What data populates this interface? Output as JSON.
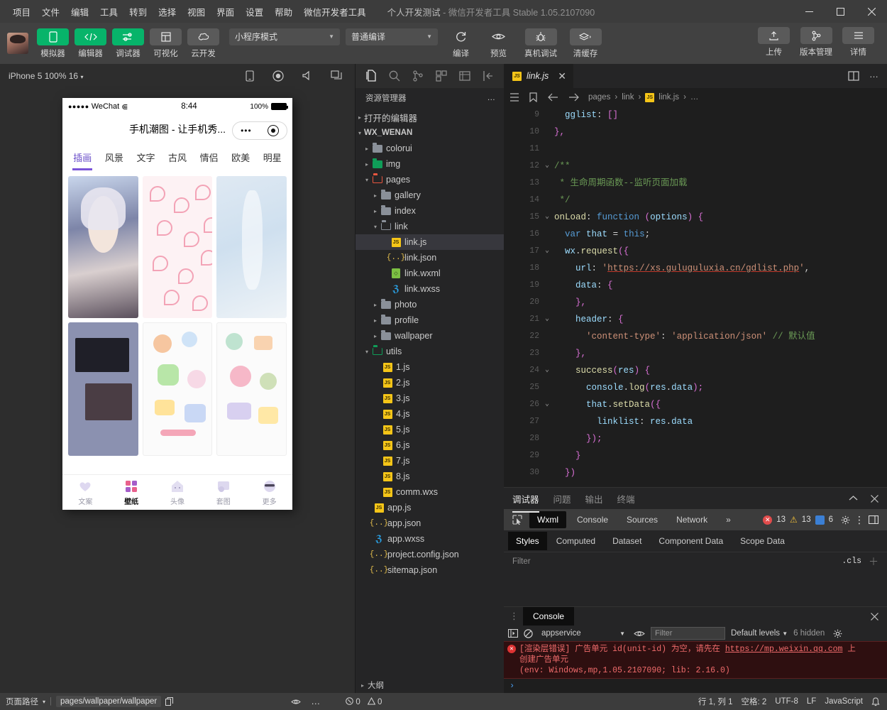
{
  "titlebar": {
    "menus": [
      "项目",
      "文件",
      "编辑",
      "工具",
      "转到",
      "选择",
      "视图",
      "界面",
      "设置",
      "帮助",
      "微信开发者工具"
    ],
    "project_name": "个人开发测试",
    "app_name": " - 微信开发者工具 ",
    "version": "Stable 1.05.2107090",
    "minimize": "—",
    "maximize": "▢",
    "close": "✕"
  },
  "toolbar": {
    "left_buttons": [
      {
        "label": "模拟器",
        "icon": "phone-icon",
        "active": true
      },
      {
        "label": "编辑器",
        "icon": "code-icon",
        "active": true
      },
      {
        "label": "调试器",
        "icon": "debug-icon",
        "active": true
      },
      {
        "label": "可视化",
        "icon": "layout-icon",
        "active": false
      },
      {
        "label": "云开发",
        "icon": "cloud-icon",
        "active": false
      }
    ],
    "mode_select": "小程序模式",
    "compile_select": "普通编译",
    "actions": [
      {
        "label": "编译",
        "icon": "refresh-icon"
      },
      {
        "label": "预览",
        "icon": "eye-icon"
      },
      {
        "label": "真机调试",
        "icon": "bug-icon"
      },
      {
        "label": "清缓存",
        "icon": "layers-icon"
      }
    ],
    "right_buttons": [
      {
        "label": "上传",
        "icon": "upload-icon"
      },
      {
        "label": "版本管理",
        "icon": "branch-icon"
      },
      {
        "label": "详情",
        "icon": "menu-icon"
      }
    ]
  },
  "simulator": {
    "device": "iPhone 5 100% 16",
    "toolbar_icons": [
      "rotate-icon",
      "record-icon",
      "volume-icon",
      "window-icon"
    ],
    "status": {
      "carrier_dots": "●●●●●",
      "carrier": "WeChat",
      "wifi": "⋐",
      "time": "8:44",
      "battery_pct": "100%"
    },
    "nav_title": "手机潮图 - 让手机秀...",
    "categories": [
      {
        "label": "插画",
        "active": true
      },
      {
        "label": "风景",
        "active": false
      },
      {
        "label": "文字",
        "active": false
      },
      {
        "label": "古风",
        "active": false
      },
      {
        "label": "情侣",
        "active": false
      },
      {
        "label": "欧美",
        "active": false
      },
      {
        "label": "明星",
        "active": false
      }
    ],
    "tabbar": [
      {
        "label": "文案",
        "icon": "heart-icon",
        "active": false
      },
      {
        "label": "壁纸",
        "icon": "grid-icon",
        "active": true
      },
      {
        "label": "头像",
        "icon": "house-icon",
        "active": false
      },
      {
        "label": "套图",
        "icon": "sticker-icon",
        "active": false
      },
      {
        "label": "更多",
        "icon": "more-face-icon",
        "active": false
      }
    ]
  },
  "explorer": {
    "activity_icons": [
      "files-icon",
      "search-icon",
      "source-control-icon",
      "extensions-icon",
      "debug-console-icon",
      "collapse-icon"
    ],
    "title": "资源管理器",
    "more": "…",
    "tree": [
      {
        "label": "打开的编辑器",
        "depth": 0,
        "type": "section",
        "twisty": "▸"
      },
      {
        "label": "WX_WENAN",
        "depth": 0,
        "type": "root",
        "twisty": "▾"
      },
      {
        "label": "colorui",
        "depth": 1,
        "type": "folder",
        "twisty": "▸",
        "color": "grey"
      },
      {
        "label": "img",
        "depth": 1,
        "type": "folder",
        "twisty": "▸",
        "color": "green"
      },
      {
        "label": "pages",
        "depth": 1,
        "type": "folder-open",
        "twisty": "▾",
        "color": "red"
      },
      {
        "label": "gallery",
        "depth": 2,
        "type": "folder",
        "twisty": "▸",
        "color": "grey"
      },
      {
        "label": "index",
        "depth": 2,
        "type": "folder",
        "twisty": "▸",
        "color": "grey"
      },
      {
        "label": "link",
        "depth": 2,
        "type": "folder-open",
        "twisty": "▾",
        "color": "grey"
      },
      {
        "label": "link.js",
        "depth": 3,
        "type": "js",
        "selected": true
      },
      {
        "label": "link.json",
        "depth": 3,
        "type": "json"
      },
      {
        "label": "link.wxml",
        "depth": 3,
        "type": "wxml"
      },
      {
        "label": "link.wxss",
        "depth": 3,
        "type": "wxss"
      },
      {
        "label": "photo",
        "depth": 2,
        "type": "folder",
        "twisty": "▸",
        "color": "grey"
      },
      {
        "label": "profile",
        "depth": 2,
        "type": "folder",
        "twisty": "▸",
        "color": "grey"
      },
      {
        "label": "wallpaper",
        "depth": 2,
        "type": "folder",
        "twisty": "▸",
        "color": "grey"
      },
      {
        "label": "utils",
        "depth": 1,
        "type": "folder-open",
        "twisty": "▾",
        "color": "green"
      },
      {
        "label": "1.js",
        "depth": 2,
        "type": "js"
      },
      {
        "label": "2.js",
        "depth": 2,
        "type": "js"
      },
      {
        "label": "3.js",
        "depth": 2,
        "type": "js"
      },
      {
        "label": "4.js",
        "depth": 2,
        "type": "js"
      },
      {
        "label": "5.js",
        "depth": 2,
        "type": "js"
      },
      {
        "label": "6.js",
        "depth": 2,
        "type": "js"
      },
      {
        "label": "7.js",
        "depth": 2,
        "type": "js"
      },
      {
        "label": "8.js",
        "depth": 2,
        "type": "js"
      },
      {
        "label": "comm.wxs",
        "depth": 2,
        "type": "js"
      },
      {
        "label": "app.js",
        "depth": 1,
        "type": "js"
      },
      {
        "label": "app.json",
        "depth": 1,
        "type": "json"
      },
      {
        "label": "app.wxss",
        "depth": 1,
        "type": "wxss"
      },
      {
        "label": "project.config.json",
        "depth": 1,
        "type": "json"
      },
      {
        "label": "sitemap.json",
        "depth": 1,
        "type": "json"
      }
    ],
    "outline_label": "大纲",
    "outline_twisty": "▸"
  },
  "editor": {
    "tab": {
      "label": "link.js",
      "icon": "js-icon",
      "close": "✕"
    },
    "tab_right_icons": [
      "split-editor-icon",
      "more-actions-icon"
    ],
    "breadcrumb_icons": [
      "outline-icon",
      "bookmark-icon",
      "back-arrow-icon",
      "forward-arrow-icon"
    ],
    "breadcrumb": [
      "pages",
      "link",
      "link.js",
      "…"
    ],
    "lines": [
      {
        "n": "9",
        "fold": "",
        "text": "    gglist: []"
      },
      {
        "n": "10",
        "fold": "",
        "text": "  },"
      },
      {
        "n": "11",
        "fold": "",
        "text": ""
      },
      {
        "n": "12",
        "fold": "⌄",
        "text": "  /**"
      },
      {
        "n": "13",
        "fold": "",
        "text": "   * 生命周期函数--监听页面加载"
      },
      {
        "n": "14",
        "fold": "",
        "text": "   */"
      },
      {
        "n": "15",
        "fold": "⌄",
        "text": "  onLoad: function (options) {"
      },
      {
        "n": "16",
        "fold": "",
        "text": "    var that = this;"
      },
      {
        "n": "17",
        "fold": "⌄",
        "text": "    wx.request({"
      },
      {
        "n": "18",
        "fold": "",
        "text": "      url: 'https://xs.guluguluxia.cn/gdlist.php',"
      },
      {
        "n": "19",
        "fold": "",
        "text": "      data: {"
      },
      {
        "n": "20",
        "fold": "",
        "text": "      },"
      },
      {
        "n": "21",
        "fold": "⌄",
        "text": "      header: {"
      },
      {
        "n": "22",
        "fold": "",
        "text": "        'content-type': 'application/json' // 默认值"
      },
      {
        "n": "23",
        "fold": "",
        "text": "      },"
      },
      {
        "n": "24",
        "fold": "⌄",
        "text": "      success(res) {"
      },
      {
        "n": "25",
        "fold": "",
        "text": "        console.log(res.data);"
      },
      {
        "n": "26",
        "fold": "⌄",
        "text": "        that.setData({"
      },
      {
        "n": "27",
        "fold": "",
        "text": "          linklist: res.data"
      },
      {
        "n": "28",
        "fold": "",
        "text": "        });"
      },
      {
        "n": "29",
        "fold": "",
        "text": "      }"
      },
      {
        "n": "30",
        "fold": "",
        "text": "    })"
      }
    ]
  },
  "debugger": {
    "panels": [
      {
        "label": "调试器",
        "active": true
      },
      {
        "label": "问题",
        "active": false
      },
      {
        "label": "输出",
        "active": false
      },
      {
        "label": "终端",
        "active": false
      }
    ],
    "collapse_icon": "chevron-up-icon",
    "close_icon": "close-icon",
    "devtools_tabs": [
      {
        "label": "Wxml",
        "active": true
      },
      {
        "label": "Console",
        "active": false
      },
      {
        "label": "Sources",
        "active": false
      },
      {
        "label": "Network",
        "active": false
      }
    ],
    "overflow": "»",
    "inspect_icon": "inspect-icon",
    "counts": {
      "errors": "13",
      "warnings": "13",
      "info": "6"
    },
    "count_icons": [
      "error-badge",
      "warning-badge",
      "info-badge"
    ],
    "right_icons": [
      "settings-gear-icon",
      "kebab-menu-icon",
      "dock-icon"
    ],
    "style_tabs": [
      {
        "label": "Styles",
        "active": true
      },
      {
        "label": "Computed",
        "active": false
      },
      {
        "label": "Dataset",
        "active": false
      },
      {
        "label": "Component Data",
        "active": false
      },
      {
        "label": "Scope Data",
        "active": false
      }
    ],
    "filter_placeholder": "Filter",
    "cls_label": ".cls",
    "plus_icon": "plus-icon"
  },
  "console": {
    "tab": "Console",
    "close_icon": "close-icon",
    "drag_icon": "drag-handle-icon",
    "toolbar_icons": [
      "sidebar-toggle-icon",
      "clear-console-icon",
      "eye-icon",
      "settings-gear-icon"
    ],
    "context": "appservice",
    "filter_placeholder": "Filter",
    "levels": "Default levels",
    "hidden": "6 hidden",
    "error": {
      "line1_prefix": "[渲染层错误] 广告单元 id(unit-id) 为空，请先在 ",
      "link": "https://mp.weixin.qq.com",
      "line1_suffix": " 上",
      "line2": "创建广告单元",
      "line3": "(env: Windows,mp,1.05.2107090; lib: 2.16.0)"
    },
    "prompt": "›"
  },
  "statusbar": {
    "page_path_label": "页面路径",
    "page_path": "pages/wallpaper/wallpaper",
    "copy_icon": "copy-icon",
    "eye_icon": "eye-icon",
    "more_icon": "more-icon",
    "errors": "0",
    "warnings": "0",
    "position": "行 1, 列 1",
    "spaces": "空格: 2",
    "encoding": "UTF-8",
    "eol": "LF",
    "language": "JavaScript",
    "bell_icon": "bell-icon"
  },
  "colors": {
    "accent_green": "#07b46a",
    "error_red": "#d33",
    "warning_yellow": "#f5c518",
    "selection_purple": "#7a54d8",
    "titlebar_bg": "#3c3c3c",
    "editor_bg": "#1e1e1e"
  }
}
